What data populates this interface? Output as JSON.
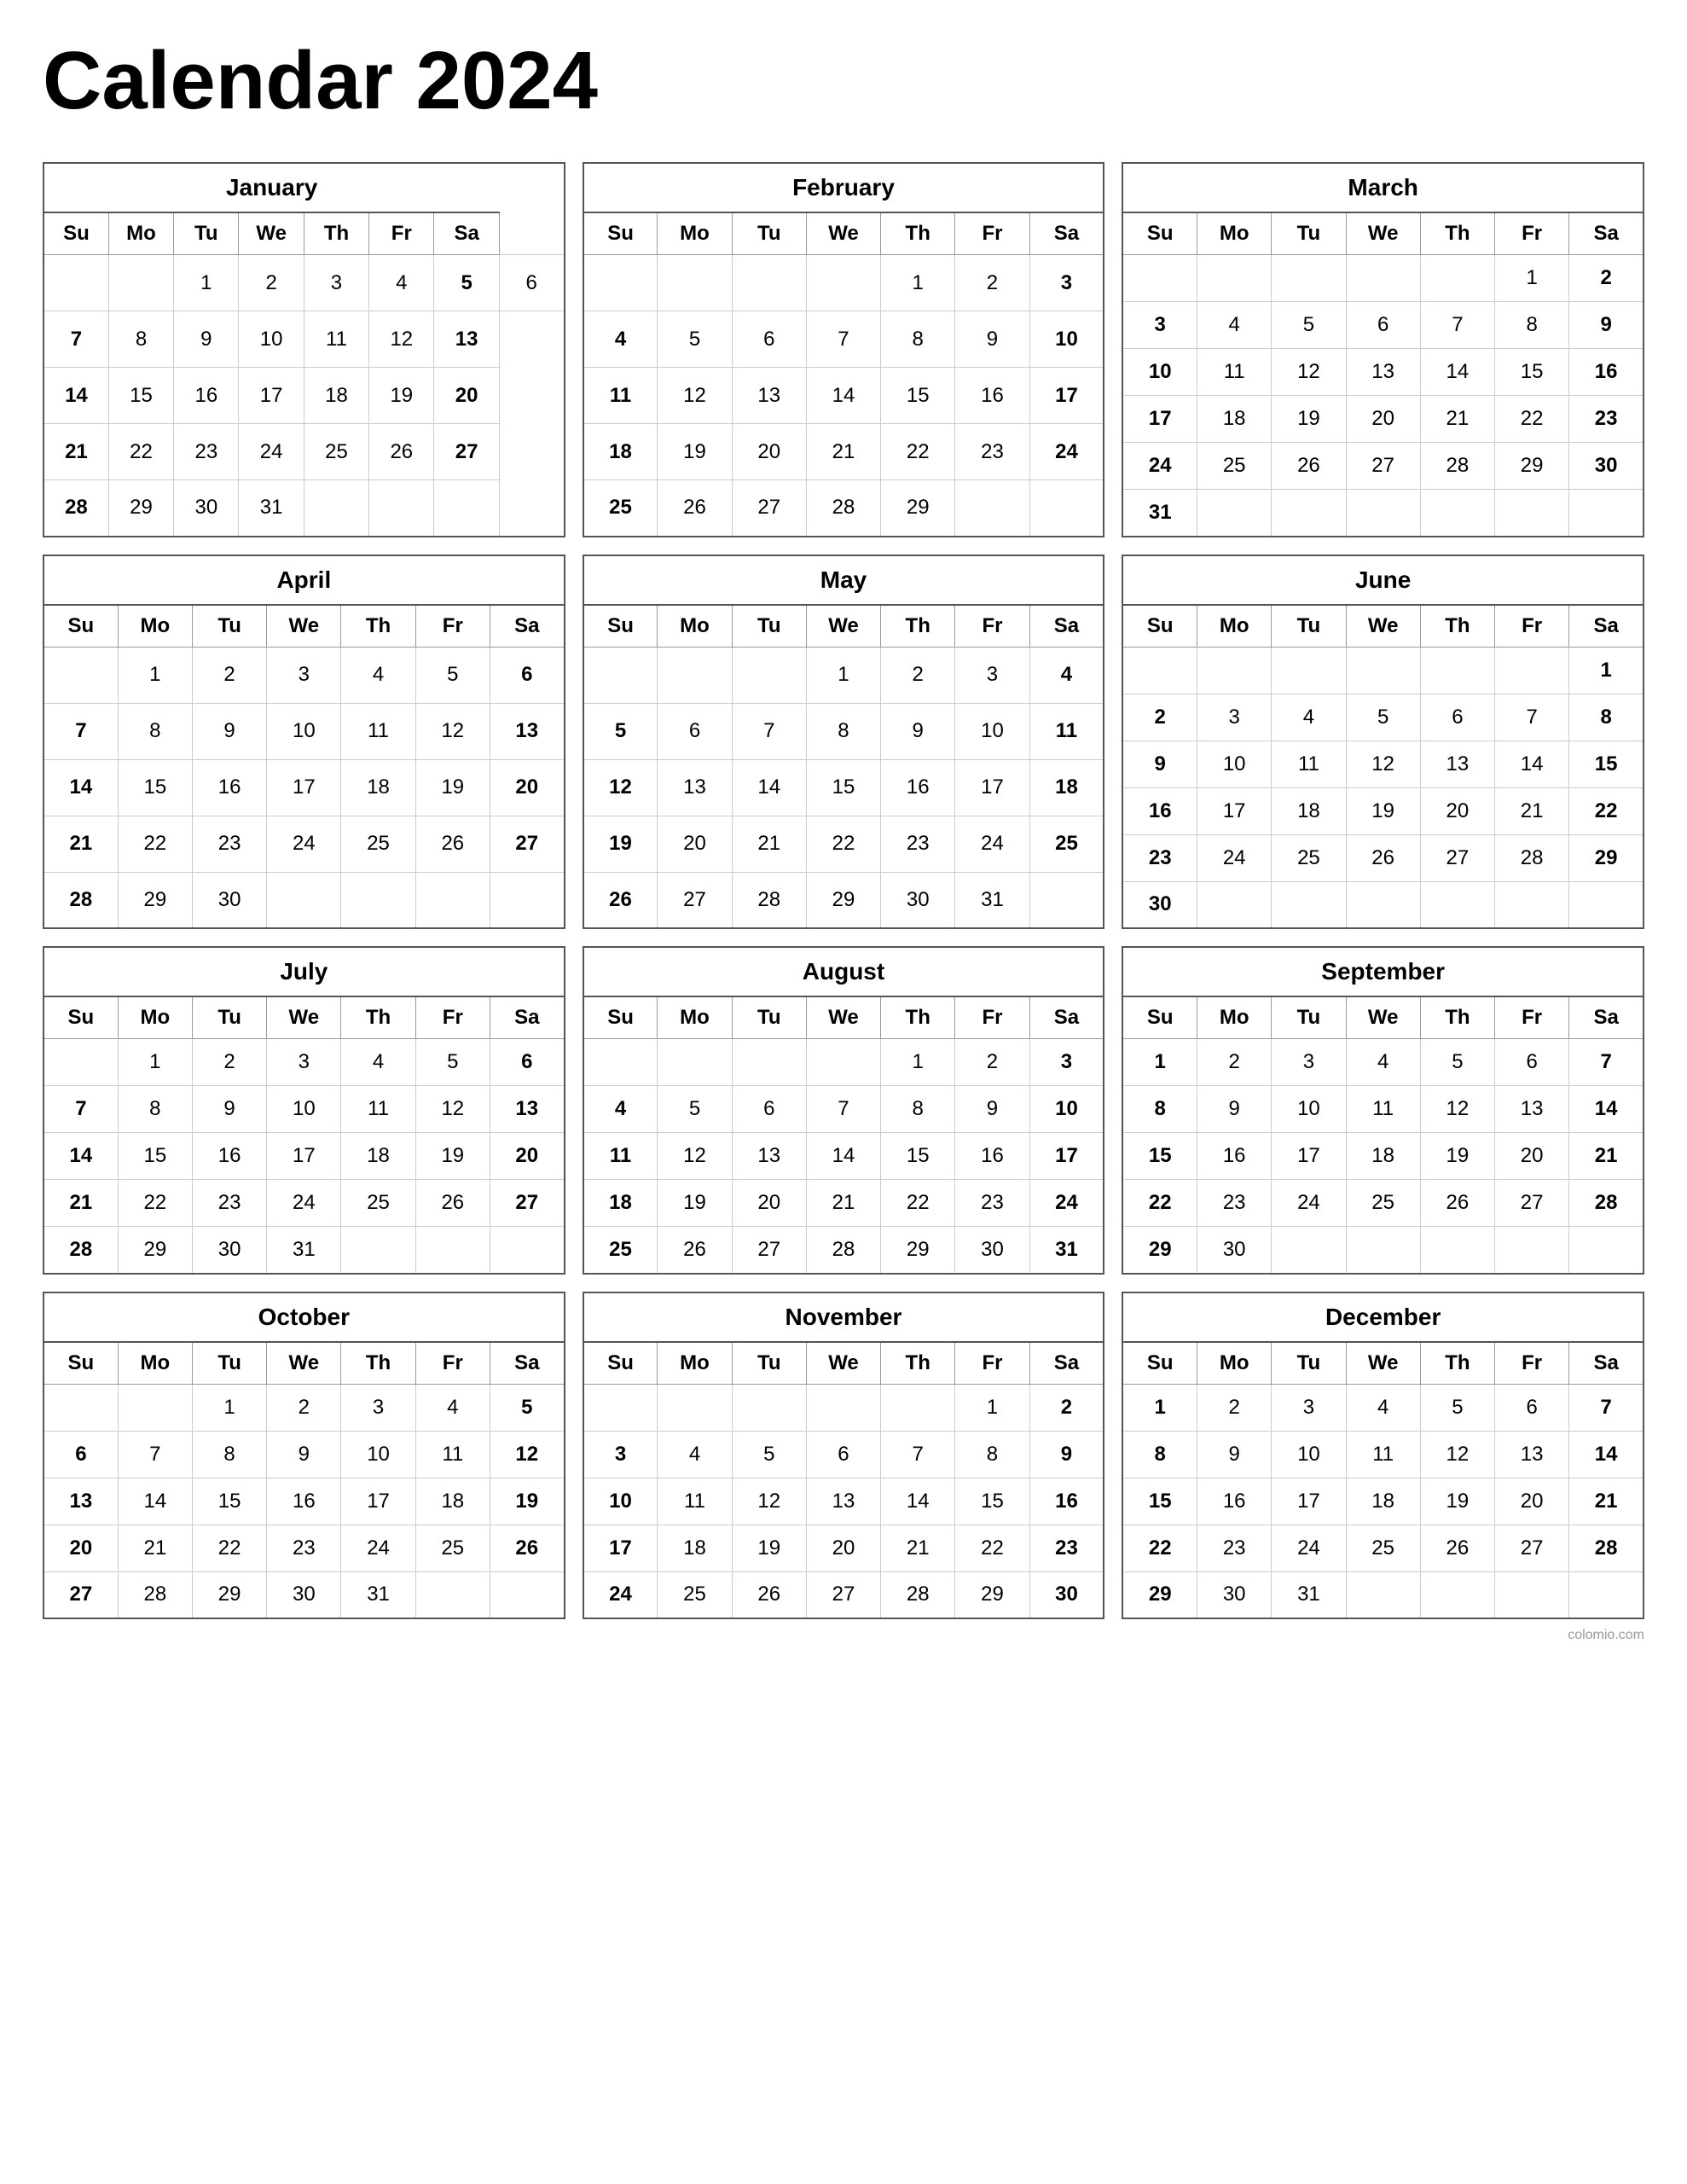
{
  "title": "Calendar 2024",
  "months": [
    {
      "name": "January",
      "days_header": [
        "Su",
        "Mo",
        "Tu",
        "We",
        "Th",
        "Fr",
        "Sa"
      ],
      "weeks": [
        [
          "",
          "",
          "1",
          "2",
          "3",
          "4",
          "5",
          "6"
        ],
        [
          "7",
          "8",
          "9",
          "10",
          "11",
          "12",
          "13"
        ],
        [
          "14",
          "15",
          "16",
          "17",
          "18",
          "19",
          "20"
        ],
        [
          "21",
          "22",
          "23",
          "24",
          "25",
          "26",
          "27"
        ],
        [
          "28",
          "29",
          "30",
          "31",
          "",
          "",
          ""
        ]
      ]
    },
    {
      "name": "February",
      "days_header": [
        "Su",
        "Mo",
        "Tu",
        "We",
        "Th",
        "Fr",
        "Sa"
      ],
      "weeks": [
        [
          "",
          "",
          "",
          "",
          "1",
          "2",
          "3"
        ],
        [
          "4",
          "5",
          "6",
          "7",
          "8",
          "9",
          "10"
        ],
        [
          "11",
          "12",
          "13",
          "14",
          "15",
          "16",
          "17"
        ],
        [
          "18",
          "19",
          "20",
          "21",
          "22",
          "23",
          "24"
        ],
        [
          "25",
          "26",
          "27",
          "28",
          "29",
          "",
          ""
        ]
      ]
    },
    {
      "name": "March",
      "days_header": [
        "Su",
        "Mo",
        "Tu",
        "We",
        "Th",
        "Fr",
        "Sa"
      ],
      "weeks": [
        [
          "",
          "",
          "",
          "",
          "",
          "1",
          "2"
        ],
        [
          "3",
          "4",
          "5",
          "6",
          "7",
          "8",
          "9"
        ],
        [
          "10",
          "11",
          "12",
          "13",
          "14",
          "15",
          "16"
        ],
        [
          "17",
          "18",
          "19",
          "20",
          "21",
          "22",
          "23"
        ],
        [
          "24",
          "25",
          "26",
          "27",
          "28",
          "29",
          "30"
        ],
        [
          "31",
          "",
          "",
          "",
          "",
          "",
          ""
        ]
      ]
    },
    {
      "name": "April",
      "days_header": [
        "Su",
        "Mo",
        "Tu",
        "We",
        "Th",
        "Fr",
        "Sa"
      ],
      "weeks": [
        [
          "",
          "1",
          "2",
          "3",
          "4",
          "5",
          "6"
        ],
        [
          "7",
          "8",
          "9",
          "10",
          "11",
          "12",
          "13"
        ],
        [
          "14",
          "15",
          "16",
          "17",
          "18",
          "19",
          "20"
        ],
        [
          "21",
          "22",
          "23",
          "24",
          "25",
          "26",
          "27"
        ],
        [
          "28",
          "29",
          "30",
          "",
          "",
          "",
          ""
        ]
      ]
    },
    {
      "name": "May",
      "days_header": [
        "Su",
        "Mo",
        "Tu",
        "We",
        "Th",
        "Fr",
        "Sa"
      ],
      "weeks": [
        [
          "",
          "",
          "",
          "1",
          "2",
          "3",
          "4"
        ],
        [
          "5",
          "6",
          "7",
          "8",
          "9",
          "10",
          "11"
        ],
        [
          "12",
          "13",
          "14",
          "15",
          "16",
          "17",
          "18"
        ],
        [
          "19",
          "20",
          "21",
          "22",
          "23",
          "24",
          "25"
        ],
        [
          "26",
          "27",
          "28",
          "29",
          "30",
          "31",
          ""
        ]
      ]
    },
    {
      "name": "June",
      "days_header": [
        "Su",
        "Mo",
        "Tu",
        "We",
        "Th",
        "Fr",
        "Sa"
      ],
      "weeks": [
        [
          "",
          "",
          "",
          "",
          "",
          "",
          "1"
        ],
        [
          "2",
          "3",
          "4",
          "5",
          "6",
          "7",
          "8"
        ],
        [
          "9",
          "10",
          "11",
          "12",
          "13",
          "14",
          "15"
        ],
        [
          "16",
          "17",
          "18",
          "19",
          "20",
          "21",
          "22"
        ],
        [
          "23",
          "24",
          "25",
          "26",
          "27",
          "28",
          "29"
        ],
        [
          "30",
          "",
          "",
          "",
          "",
          "",
          ""
        ]
      ]
    },
    {
      "name": "July",
      "days_header": [
        "Su",
        "Mo",
        "Tu",
        "We",
        "Th",
        "Fr",
        "Sa"
      ],
      "weeks": [
        [
          "",
          "1",
          "2",
          "3",
          "4",
          "5",
          "6"
        ],
        [
          "7",
          "8",
          "9",
          "10",
          "11",
          "12",
          "13"
        ],
        [
          "14",
          "15",
          "16",
          "17",
          "18",
          "19",
          "20"
        ],
        [
          "21",
          "22",
          "23",
          "24",
          "25",
          "26",
          "27"
        ],
        [
          "28",
          "29",
          "30",
          "31",
          "",
          "",
          ""
        ]
      ]
    },
    {
      "name": "August",
      "days_header": [
        "Su",
        "Mo",
        "Tu",
        "We",
        "Th",
        "Fr",
        "Sa"
      ],
      "weeks": [
        [
          "",
          "",
          "",
          "",
          "1",
          "2",
          "3"
        ],
        [
          "4",
          "5",
          "6",
          "7",
          "8",
          "9",
          "10"
        ],
        [
          "11",
          "12",
          "13",
          "14",
          "15",
          "16",
          "17"
        ],
        [
          "18",
          "19",
          "20",
          "21",
          "22",
          "23",
          "24"
        ],
        [
          "25",
          "26",
          "27",
          "28",
          "29",
          "30",
          "31"
        ]
      ]
    },
    {
      "name": "September",
      "days_header": [
        "Su",
        "Mo",
        "Tu",
        "We",
        "Th",
        "Fr",
        "Sa"
      ],
      "weeks": [
        [
          "1",
          "2",
          "3",
          "4",
          "5",
          "6",
          "7"
        ],
        [
          "8",
          "9",
          "10",
          "11",
          "12",
          "13",
          "14"
        ],
        [
          "15",
          "16",
          "17",
          "18",
          "19",
          "20",
          "21"
        ],
        [
          "22",
          "23",
          "24",
          "25",
          "26",
          "27",
          "28"
        ],
        [
          "29",
          "30",
          "",
          "",
          "",
          "",
          ""
        ]
      ]
    },
    {
      "name": "October",
      "days_header": [
        "Su",
        "Mo",
        "Tu",
        "We",
        "Th",
        "Fr",
        "Sa"
      ],
      "weeks": [
        [
          "",
          "",
          "1",
          "2",
          "3",
          "4",
          "5"
        ],
        [
          "6",
          "7",
          "8",
          "9",
          "10",
          "11",
          "12"
        ],
        [
          "13",
          "14",
          "15",
          "16",
          "17",
          "18",
          "19"
        ],
        [
          "20",
          "21",
          "22",
          "23",
          "24",
          "25",
          "26"
        ],
        [
          "27",
          "28",
          "29",
          "30",
          "31",
          "",
          ""
        ]
      ]
    },
    {
      "name": "November",
      "days_header": [
        "Su",
        "Mo",
        "Tu",
        "We",
        "Th",
        "Fr",
        "Sa"
      ],
      "weeks": [
        [
          "",
          "",
          "",
          "",
          "",
          "1",
          "2"
        ],
        [
          "3",
          "4",
          "5",
          "6",
          "7",
          "8",
          "9"
        ],
        [
          "10",
          "11",
          "12",
          "13",
          "14",
          "15",
          "16"
        ],
        [
          "17",
          "18",
          "19",
          "20",
          "21",
          "22",
          "23"
        ],
        [
          "24",
          "25",
          "26",
          "27",
          "28",
          "29",
          "30"
        ]
      ]
    },
    {
      "name": "December",
      "days_header": [
        "Su",
        "Mo",
        "Tu",
        "We",
        "Th",
        "Fr",
        "Sa"
      ],
      "weeks": [
        [
          "1",
          "2",
          "3",
          "4",
          "5",
          "6",
          "7"
        ],
        [
          "8",
          "9",
          "10",
          "11",
          "12",
          "13",
          "14"
        ],
        [
          "15",
          "16",
          "17",
          "18",
          "19",
          "20",
          "21"
        ],
        [
          "22",
          "23",
          "24",
          "25",
          "26",
          "27",
          "28"
        ],
        [
          "29",
          "30",
          "31",
          "",
          "",
          "",
          ""
        ]
      ]
    }
  ],
  "watermark": "colomio.com"
}
